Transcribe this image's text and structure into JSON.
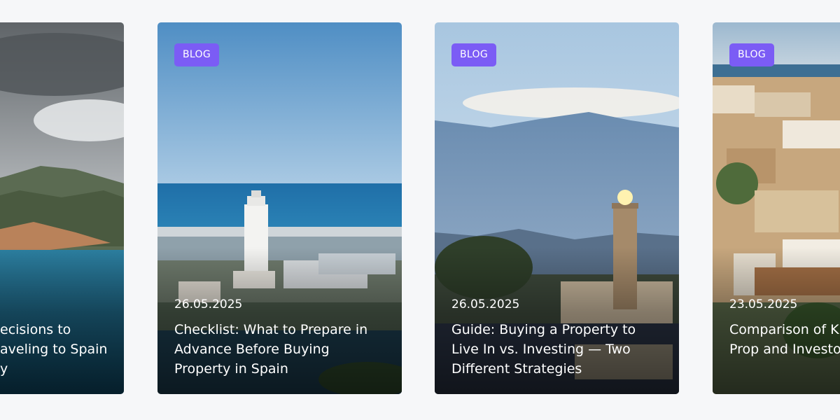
{
  "cards": [
    {
      "badge": "",
      "date": "",
      "title": "ecisions to\naveling to Spain\ny"
    },
    {
      "badge": "BLOG",
      "date": "26.05.2025",
      "title": "Checklist: What to Prepare in Advance Before Buying Property in Spain"
    },
    {
      "badge": "BLOG",
      "date": "26.05.2025",
      "title": "Guide: Buying a Property to Live In vs. Investing — Two Different Strategies"
    },
    {
      "badge": "BLOG",
      "date": "23.05.2025",
      "title": "Comparison of K Regions for Prop and Investors"
    }
  ],
  "colors": {
    "page_bg": "#f6f7f9",
    "badge_bg": "#7b5cf5",
    "text": "#ffffff"
  }
}
